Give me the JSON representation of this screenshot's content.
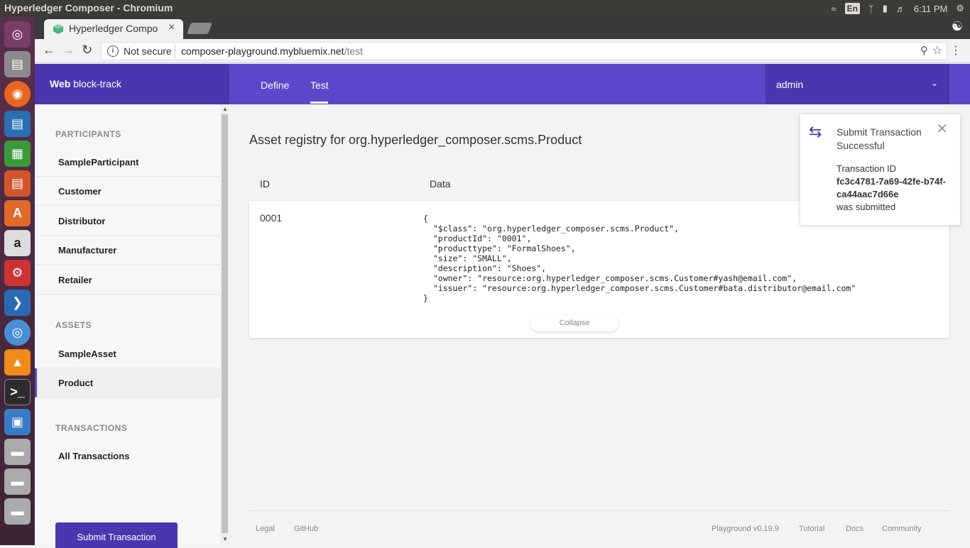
{
  "os": {
    "window_title": "Hyperledger Composer - Chromium",
    "lang": "En",
    "clock": "6:11 PM"
  },
  "browser": {
    "tab_title": "Hyperledger Compo",
    "not_secure": "Not secure",
    "url_host": "composer-playground.mybluemix.net",
    "url_path": "/test"
  },
  "header": {
    "brand_bold": "Web",
    "brand_name": "block-track",
    "tabs": [
      "Define",
      "Test"
    ],
    "active_tab": "Test",
    "user": "admin"
  },
  "sidebar": {
    "participants_head": "PARTICIPANTS",
    "participants": [
      "SampleParticipant",
      "Customer",
      "Distributor",
      "Manufacturer",
      "Retailer"
    ],
    "assets_head": "ASSETS",
    "assets": [
      "SampleAsset",
      "Product"
    ],
    "active_item": "Product",
    "transactions_head": "TRANSACTIONS",
    "transactions": [
      "All Transactions"
    ],
    "submit_label": "Submit Transaction"
  },
  "main": {
    "registry_title": "Asset registry for org.hyperledger_composer.scms.Product",
    "col_id": "ID",
    "col_data": "Data",
    "asset": {
      "id": "0001",
      "json": "{\n  \"$class\": \"org.hyperledger_composer.scms.Product\",\n  \"productId\": \"0001\",\n  \"producttype\": \"FormalShoes\",\n  \"size\": \"SMALL\",\n  \"description\": \"Shoes\",\n  \"owner\": \"resource:org.hyperledger_composer.scms.Customer#yash@email.com\",\n  \"issuer\": \"resource:org.hyperledger_composer.scms.Customer#bata.distributor@email.com\"\n}",
      "collapse_label": "Collapse"
    }
  },
  "toast": {
    "title": "Submit Transaction Successful",
    "label": "Transaction ID",
    "tx_id": "fc3c4781-7a69-42fe-b74f-ca44aac7d66e",
    "suffix": "was submitted"
  },
  "footer": {
    "legal": "Legal",
    "github": "GitHub",
    "version": "Playground v0.19.9",
    "tutorial": "Tutorial",
    "docs": "Docs",
    "community": "Community"
  },
  "colors": {
    "brand_dark": "#4a37b0",
    "brand": "#5c46c9"
  }
}
